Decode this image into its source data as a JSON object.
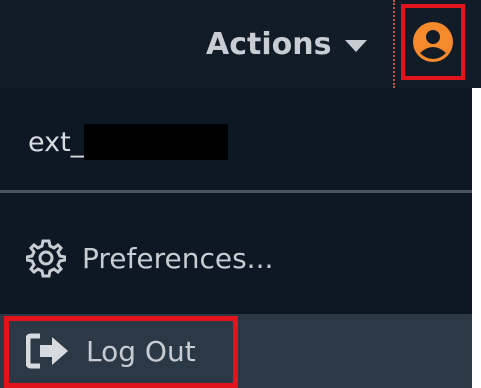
{
  "header": {
    "actions_label": "Actions",
    "caret_icon": "caret-down-icon",
    "user_icon": "user-avatar-icon"
  },
  "menu": {
    "username_prefix": "ext_",
    "username_redacted": true,
    "items": [
      {
        "label": "Preferences...",
        "icon": "gear-icon"
      },
      {
        "label": "Log Out",
        "icon": "sign-out-icon"
      }
    ]
  },
  "colors": {
    "topbar_bg": "#121c27",
    "menu_bg": "#0d1824",
    "hover_bg": "#2b3946",
    "accent_orange": "#f58a2c",
    "highlight_red": "#e3131b",
    "text": "#c7ccd2"
  }
}
